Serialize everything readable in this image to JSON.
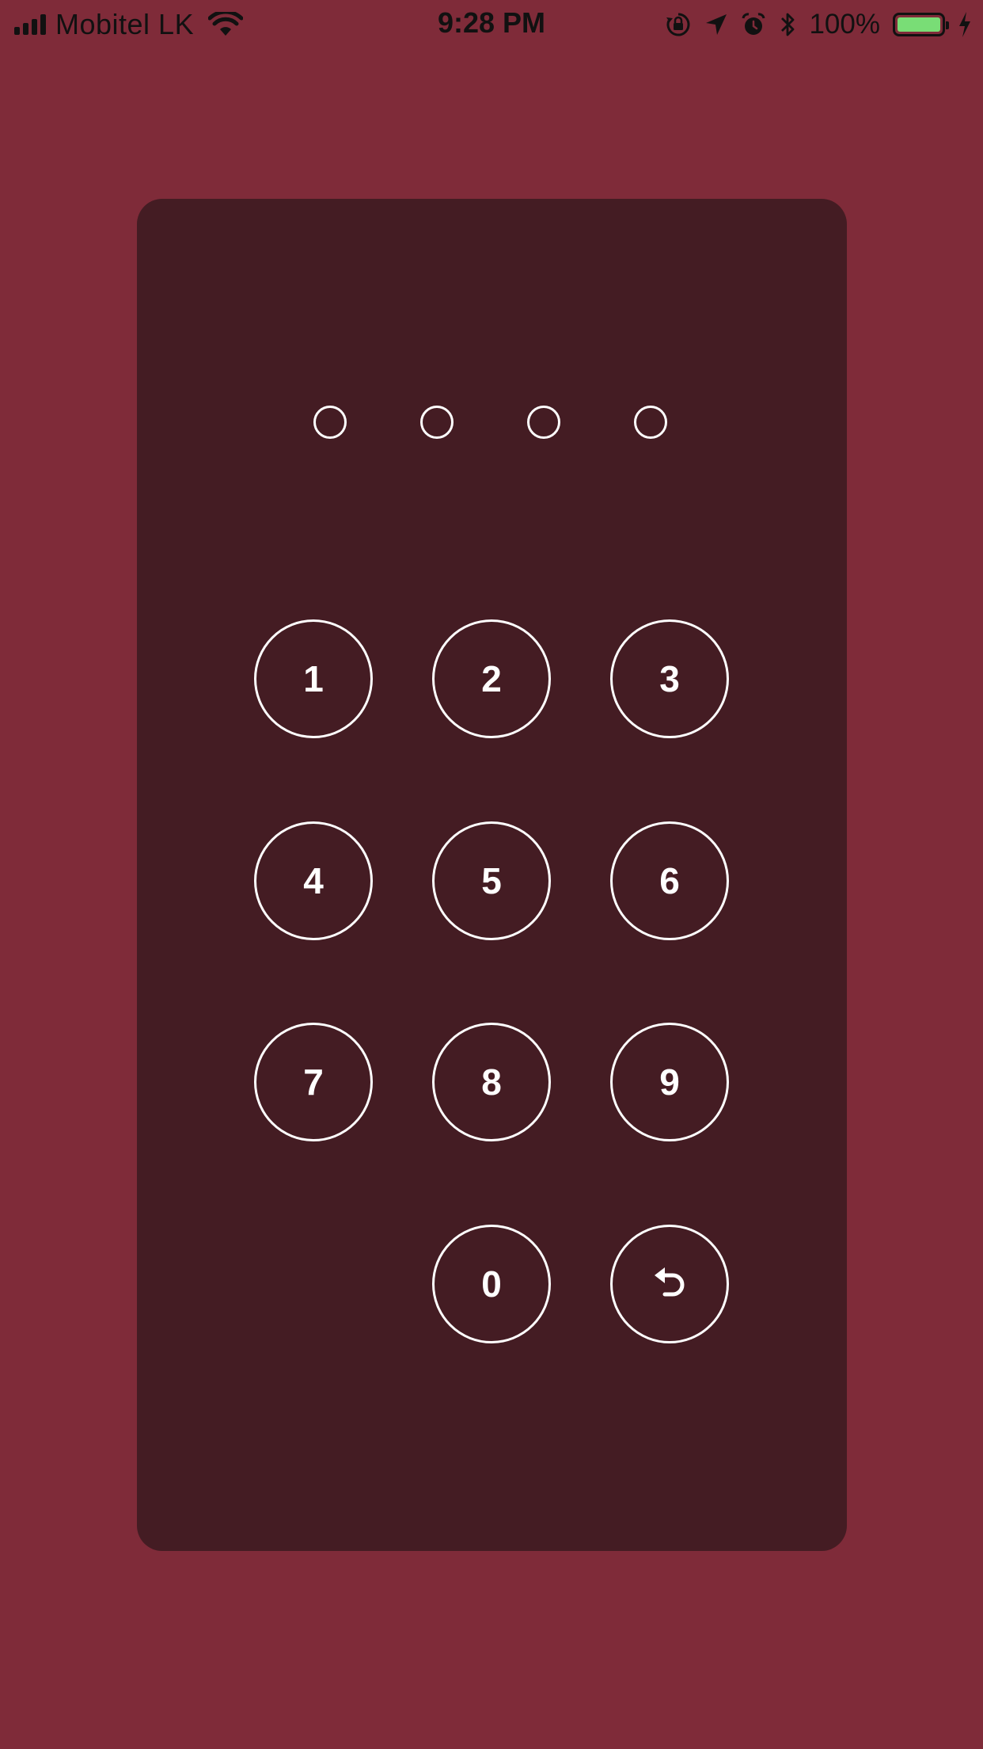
{
  "status_bar": {
    "carrier": "Mobitel LK",
    "time": "9:28 PM",
    "battery_percent": "100%",
    "icons": [
      "signal-icon",
      "wifi-icon",
      "rotation-lock-icon",
      "location-icon",
      "alarm-icon",
      "bluetooth-icon",
      "battery-icon",
      "charging-icon"
    ]
  },
  "passcode": {
    "digits_total": 4,
    "digits_entered": 0
  },
  "keypad": {
    "keys": [
      "1",
      "2",
      "3",
      "4",
      "5",
      "6",
      "7",
      "8",
      "9",
      "0"
    ],
    "back_icon": "undo-arrow-icon"
  },
  "colors": {
    "background": "#7f2b39",
    "card": "#441c23",
    "foreground": "#ffffff",
    "battery": "#79dd76"
  }
}
